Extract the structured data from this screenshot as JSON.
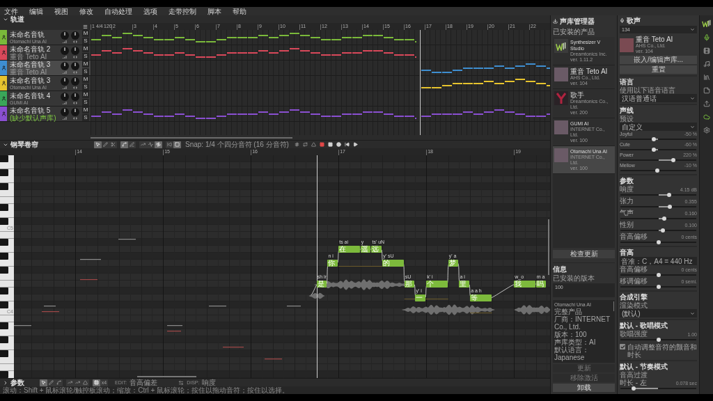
{
  "menu": [
    "文件",
    "编辑",
    "视图",
    "修改",
    "自动处理",
    "选项",
    "走带控制",
    "脚本",
    "帮助"
  ],
  "arrangement": {
    "title": "轨道",
    "expanded": true,
    "ruler": {
      "marks": [
        "1",
        "2",
        "3",
        "4",
        "5",
        "6",
        "7",
        "8",
        "9",
        "10",
        "11",
        "12",
        "13",
        "14",
        "15",
        "16",
        "17",
        "18",
        "19",
        "20",
        "21",
        "22"
      ],
      "time_signature": "4/4",
      "tempo": "120"
    },
    "tracks": [
      {
        "name": "未命名音轨",
        "voice": "Otomachi Una AI",
        "voice_missing": false,
        "color": "#7ab93a",
        "selected": false,
        "kind": "early",
        "mute": "M",
        "solo": "S"
      },
      {
        "name": "未命名音轨 2",
        "voice": "重音 Teto AI",
        "voice_missing": false,
        "color": "#d9485a",
        "selected": false,
        "kind": "early",
        "mute": "M",
        "solo": "S"
      },
      {
        "name": "未命名音轨 3",
        "voice": "重音 Teto AI",
        "voice_missing": false,
        "color": "#3e8ed0",
        "selected": true,
        "kind": "late",
        "mute": "M",
        "solo": "S"
      },
      {
        "name": "未命名音轨 3",
        "voice": "Otomachi Una AI",
        "voice_missing": false,
        "color": "#e6c32e",
        "selected": false,
        "kind": "late",
        "mute": "M",
        "solo": "S"
      },
      {
        "name": "未命名音轨 4",
        "voice": "GUMI AI",
        "voice_missing": false,
        "color": "#3aa659",
        "selected": false,
        "kind": "empty",
        "mute": "M",
        "solo": "S"
      },
      {
        "name": "未命名音轨 5",
        "voice": "(缺少默认声库)",
        "voice_missing": true,
        "color": "#8a4fd1",
        "selected": false,
        "kind": "full",
        "mute": "M",
        "solo": "S"
      }
    ]
  },
  "piano_roll": {
    "title": "钢琴卷帘",
    "expanded": true,
    "tool_groups": [
      [
        {
          "kind": "pointer",
          "selected": true
        },
        {
          "kind": "pencil",
          "selected": false
        },
        {
          "kind": "scissors",
          "selected": false
        }
      ],
      [
        {
          "kind": "pitch-pointer",
          "selected": true
        },
        {
          "kind": "pitch-pencil",
          "selected": false
        }
      ],
      [
        {
          "kind": "line",
          "selected": false
        },
        {
          "kind": "wave",
          "selected": false
        },
        {
          "kind": "vibrato",
          "selected": true
        }
      ],
      [
        {
          "kind": "rewind",
          "selected": false
        },
        {
          "kind": "block",
          "selected": true
        }
      ]
    ],
    "snap": "Snap: 1/4 个四分音符 (16 分音符)",
    "transport": [
      {
        "kind": "sharp"
      },
      {
        "kind": "loop"
      },
      {
        "kind": "metronome"
      },
      {
        "kind": "record"
      },
      {
        "kind": "stop"
      },
      {
        "kind": "dot"
      },
      {
        "kind": "skip-back"
      },
      {
        "kind": "play"
      }
    ],
    "ruler": [
      "14",
      "15",
      "16",
      "17",
      "18",
      "19"
    ],
    "key_labels": [
      "C5",
      "C4"
    ],
    "notes": [
      {
        "lyric": "是",
        "phoneme": "sh ir"
      },
      {
        "lyric": "你",
        "phoneme": "n i"
      },
      {
        "lyric": "在",
        "phoneme": "ts ai"
      },
      {
        "lyric": "遥",
        "phoneme": "y"
      },
      {
        "lyric": "远",
        "phoneme": "ts' uN"
      },
      {
        "lyric": "的",
        "phoneme": "y' sU"
      },
      {
        "lyric": "那",
        "phoneme": "sU"
      },
      {
        "lyric": "一",
        "phoneme": "y' i"
      },
      {
        "lyric": "个",
        "phoneme": "k' i"
      },
      {
        "lyric": "梦",
        "phoneme": "y' a"
      },
      {
        "lyric": "里",
        "phoneme": "a i"
      },
      {
        "lyric": "等",
        "phoneme": "a a h"
      },
      {
        "lyric": "我",
        "phoneme": "w_o"
      },
      {
        "lyric": "吗",
        "phoneme": "m a"
      }
    ]
  },
  "parameters": {
    "title": "参数",
    "expanded": false,
    "tool_groups": [
      [
        {
          "kind": "pointer",
          "selected": true
        },
        {
          "kind": "pencil",
          "selected": false
        },
        {
          "kind": "curve",
          "selected": false
        }
      ],
      [
        {
          "kind": "line",
          "selected": false
        },
        {
          "kind": "ramp",
          "selected": false
        },
        {
          "kind": "bell",
          "selected": false
        }
      ],
      [
        {
          "kind": "snap",
          "selected": true
        },
        {
          "kind": "text",
          "label": "x4",
          "selected": false
        }
      ]
    ],
    "edit_label": "EDIT:",
    "edit_value": "音高偏差",
    "display_label": "DISP:",
    "display_value": "响度"
  },
  "status": "滚动：Shift + 鼠标滚轮/触控板滚动；缩放：Ctrl + 鼠标滚轮；按住以拖动音符；按住以选择。",
  "voice_manager": {
    "title": "声库管理器",
    "installed_label": "已安装的产品",
    "products": [
      {
        "name": "Synthesizer V Studio",
        "vendor": "Dreamtonics Inc.",
        "version": "ver. 1.11.2",
        "kind": "app",
        "selected": false
      },
      {
        "name": "重音 Teto AI",
        "vendor": "AHS Co., Ltd.",
        "version": "ver. 104",
        "kind": "portrait",
        "selected": false
      },
      {
        "name": "歌手",
        "vendor": "Dreamtonics Co., Ltd.",
        "version": "ver. 200",
        "kind": "letter",
        "selected": false
      },
      {
        "name": "GUMI AI",
        "vendor": "INTERNET Co., Ltd.",
        "version": "ver. 100",
        "kind": "portrait",
        "selected": false
      },
      {
        "name": "Otomachi Una AI",
        "vendor": "INTERNET Co., Ltd.",
        "version": "ver. 100",
        "kind": "portrait",
        "selected": true
      }
    ],
    "check_updates": "检查更新",
    "info": {
      "title": "信息",
      "version_label": "已安装的版本",
      "version": "100",
      "details": [
        "Otomachi Una AI",
        "完整产品",
        "厂商：INTERNET Co., Ltd.",
        "版本：100",
        "声库类型：AI",
        "默认语言：Japanese"
      ]
    },
    "actions": [
      {
        "label": "更新",
        "disabled": true
      },
      {
        "label": "移除激活",
        "disabled": true
      },
      {
        "label": "卸载",
        "disabled": false
      }
    ]
  },
  "voice": {
    "title": "歌声",
    "preset": "134",
    "singer": {
      "name": "重音 Teto AI",
      "vendor": "AHS Co., Ltd.",
      "version": "ver. 104"
    },
    "buttons": [
      "嵌入/编辑声库...",
      "重置"
    ],
    "sections": [
      {
        "title": "语言",
        "rows": [
          {
            "kind": "label",
            "text": "使用以下语音语言"
          },
          {
            "kind": "dropdown",
            "value": "汉语普通话"
          }
        ]
      },
      {
        "title": "声线",
        "rows": [
          {
            "kind": "label",
            "text": "预设"
          },
          {
            "kind": "dropdown",
            "value": "自定义"
          },
          {
            "kind": "slider",
            "label": "Joyful",
            "reading": "-50 %",
            "level": 0.44
          },
          {
            "kind": "slider",
            "label": "Cute",
            "reading": "-60 %",
            "level": 0.44
          },
          {
            "kind": "slider",
            "label": "Power",
            "reading": "220 %",
            "level": 0.71
          },
          {
            "kind": "slider",
            "label": "Mellow",
            "reading": "-10 %",
            "level": 0.49
          }
        ]
      },
      {
        "title": "参数",
        "rows": [
          {
            "kind": "slider",
            "label": "响度",
            "reading": "4.15 dB",
            "level": 0.65
          },
          {
            "kind": "slider",
            "label": "张力",
            "reading": "0.355",
            "level": 0.66
          },
          {
            "kind": "slider",
            "label": "气声",
            "reading": "0.160",
            "level": 0.58
          },
          {
            "kind": "slider",
            "label": "性别",
            "reading": "0.100",
            "level": 0.56
          },
          {
            "kind": "slider",
            "label": "音高偏移",
            "reading": "0 cents",
            "level": 0.5
          }
        ]
      },
      {
        "title": "音高",
        "rows": [
          {
            "kind": "field",
            "value": "音准：C，A4 = 440 Hz"
          },
          {
            "kind": "slider",
            "label": "音高偏移",
            "reading": "0 cents",
            "level": 0.5
          },
          {
            "kind": "slider",
            "label": "移调偏移",
            "reading": "0 semi.",
            "level": 0.5
          }
        ]
      },
      {
        "title": "合成引擎",
        "rows": [
          {
            "kind": "label",
            "text": "渲染模式"
          },
          {
            "kind": "dropdown",
            "value": "(默认)"
          }
        ]
      },
      {
        "title": "默认 - 歌唱模式",
        "rows": [
          {
            "kind": "slider",
            "label": "歌唱强度",
            "reading": "1.00",
            "level": 0.5
          },
          {
            "kind": "checkbox",
            "label": "自动调整音符的颤音和时长",
            "checked": true
          }
        ]
      },
      {
        "title": "默认 - 节奏模式",
        "rows": [
          {
            "kind": "label",
            "text": "音高过渡"
          },
          {
            "kind": "slider",
            "label": "时长 - 左",
            "reading": "0.078 sec",
            "level": 0.16
          }
        ]
      }
    ]
  },
  "rail": [
    {
      "kind": "mic",
      "selected": true
    },
    {
      "kind": "film",
      "selected": false
    },
    {
      "kind": "music",
      "selected": false
    },
    {
      "kind": "library",
      "selected": false
    },
    {
      "kind": "note",
      "selected": false
    },
    {
      "kind": "export",
      "selected": false
    },
    {
      "kind": "cloud",
      "selected": true
    },
    {
      "kind": "settings",
      "selected": false
    }
  ]
}
